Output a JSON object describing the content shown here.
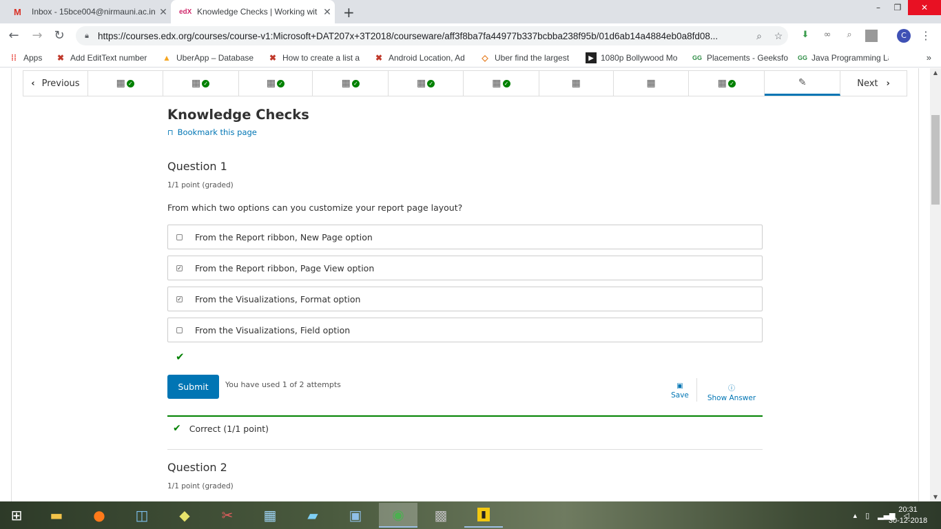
{
  "browser": {
    "tabs": [
      {
        "title": "Inbox - 15bce004@nirmauni.ac.in",
        "icon": "gmail-icon",
        "favicon_text": "M"
      },
      {
        "title": "Knowledge Checks | Working wit",
        "icon": "edx-icon",
        "favicon_text": "edX"
      }
    ],
    "new_tab": "+",
    "window_controls": {
      "minimize": "–",
      "maximize": "❐",
      "close": "✕"
    },
    "url": "https://courses.edx.org/courses/course-v1:Microsoft+DAT207x+3T2018/courseware/aff3f8ba7fa44977b337bcbba238f95b/01d6ab14a4884eb0a8fd08...",
    "profile_initial": "C"
  },
  "bookmarks": [
    {
      "label": "Apps",
      "icon": "apps-grid-icon"
    },
    {
      "label": "Add EditText number",
      "icon": "red-x-icon"
    },
    {
      "label": "UberApp – Database",
      "icon": "firebase-icon"
    },
    {
      "label": "How to create a list a",
      "icon": "red-x-icon"
    },
    {
      "label": "Android Location, Ad",
      "icon": "red-x-icon"
    },
    {
      "label": "Uber find the largest",
      "icon": "blog-icon"
    },
    {
      "label": "1080p Bollywood Mo",
      "icon": "video-icon"
    },
    {
      "label": "Placements - Geeksfo",
      "icon": "geeksforgeeks-icon"
    },
    {
      "label": "Java Programming La",
      "icon": "geeksforgeeks-icon"
    }
  ],
  "sequence_nav": {
    "previous": "Previous",
    "next": "Next",
    "units": [
      {
        "type": "video",
        "completed": true
      },
      {
        "type": "video",
        "completed": true
      },
      {
        "type": "video",
        "completed": true
      },
      {
        "type": "video",
        "completed": true
      },
      {
        "type": "video",
        "completed": true
      },
      {
        "type": "video",
        "completed": true
      },
      {
        "type": "video",
        "completed": false
      },
      {
        "type": "video",
        "completed": false
      },
      {
        "type": "video",
        "completed": true
      },
      {
        "type": "problem",
        "completed": false,
        "active": true
      }
    ]
  },
  "unit": {
    "title": "Knowledge Checks",
    "bookmark_label": "Bookmark this page"
  },
  "question1": {
    "title": "Question 1",
    "points": "1/1 point (graded)",
    "text": "From which two options can you customize your report page layout?",
    "options": [
      {
        "label": "From the Report ribbon, New Page option",
        "checked": false
      },
      {
        "label": "From the Report ribbon, Page View option",
        "checked": true
      },
      {
        "label": "From the Visualizations, Format option",
        "checked": true
      },
      {
        "label": "From the Visualizations, Field option",
        "checked": false
      }
    ],
    "submit_label": "Submit",
    "attempts": "You have used 1 of 2 attempts",
    "save_label": "Save",
    "show_answer_label": "Show Answer",
    "notification": "Correct (1/1 point)"
  },
  "question2": {
    "title": "Question 2",
    "points": "1/1 point (graded)"
  },
  "taskbar": {
    "time": "20:31",
    "date": "30-12-2018"
  },
  "colors": {
    "accent": "#0075b4",
    "success": "#008100"
  }
}
